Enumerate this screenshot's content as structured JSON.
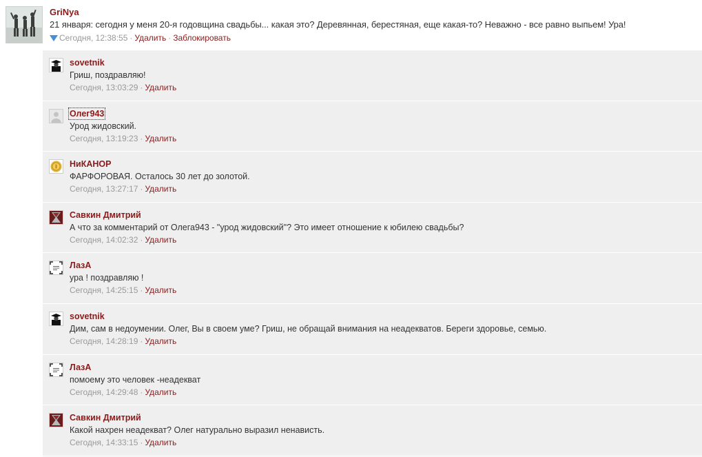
{
  "post": {
    "author": "GriNya",
    "text": "21 января: сегодня у меня 20-я годовщина свадьбы... какая это? Деревянная, берестяная, еще какая-то? Неважно - все равно выпьем! Ура!",
    "timestamp": "Сегодня, 12:38:55",
    "delete_label": "Удалить",
    "block_label": "Заблокировать"
  },
  "colors": {
    "link": "#8b1a1a",
    "meta": "#999999",
    "thread_bg": "#efefef",
    "triangle": "#4a8fd6"
  },
  "comments": [
    {
      "author": "sovetnik",
      "text": "Гриш, поздравляю!",
      "timestamp": "Сегодня, 13:03:29",
      "delete_label": "Удалить"
    },
    {
      "author": "Олег943",
      "text": "Урод жидовский.",
      "timestamp": "Сегодня, 13:19:23",
      "delete_label": "Удалить"
    },
    {
      "author": "НиКАНОР",
      "text": "ФАРФОРОВАЯ. Осталось 30 лет до золотой.",
      "timestamp": "Сегодня, 13:27:17",
      "delete_label": "Удалить"
    },
    {
      "author": "Савкин Дмитрий",
      "text": "А что за комментарий от Олега943 - \"урод жидовский\"? Это имеет отношение к юбилею свадьбы?",
      "timestamp": "Сегодня, 14:02:32",
      "delete_label": "Удалить"
    },
    {
      "author": "ЛазА",
      "text": "ура ! поздравляю !",
      "timestamp": "Сегодня, 14:25:15",
      "delete_label": "Удалить"
    },
    {
      "author": "sovetnik",
      "text": "Дим, сам в недоумении. Олег, Вы в своем уме? Гриш, не обращай внимания на неадекватов. Береги здоровье, семью.",
      "timestamp": "Сегодня, 14:28:19",
      "delete_label": "Удалить"
    },
    {
      "author": "ЛазА",
      "text": "помоему это человек -неадекват",
      "timestamp": "Сегодня, 14:29:48",
      "delete_label": "Удалить"
    },
    {
      "author": "Савкин Дмитрий",
      "text": "Какой нахрен неадекват? Олег натурально выразил ненависть.",
      "timestamp": "Сегодня, 14:33:15",
      "delete_label": "Удалить"
    }
  ]
}
